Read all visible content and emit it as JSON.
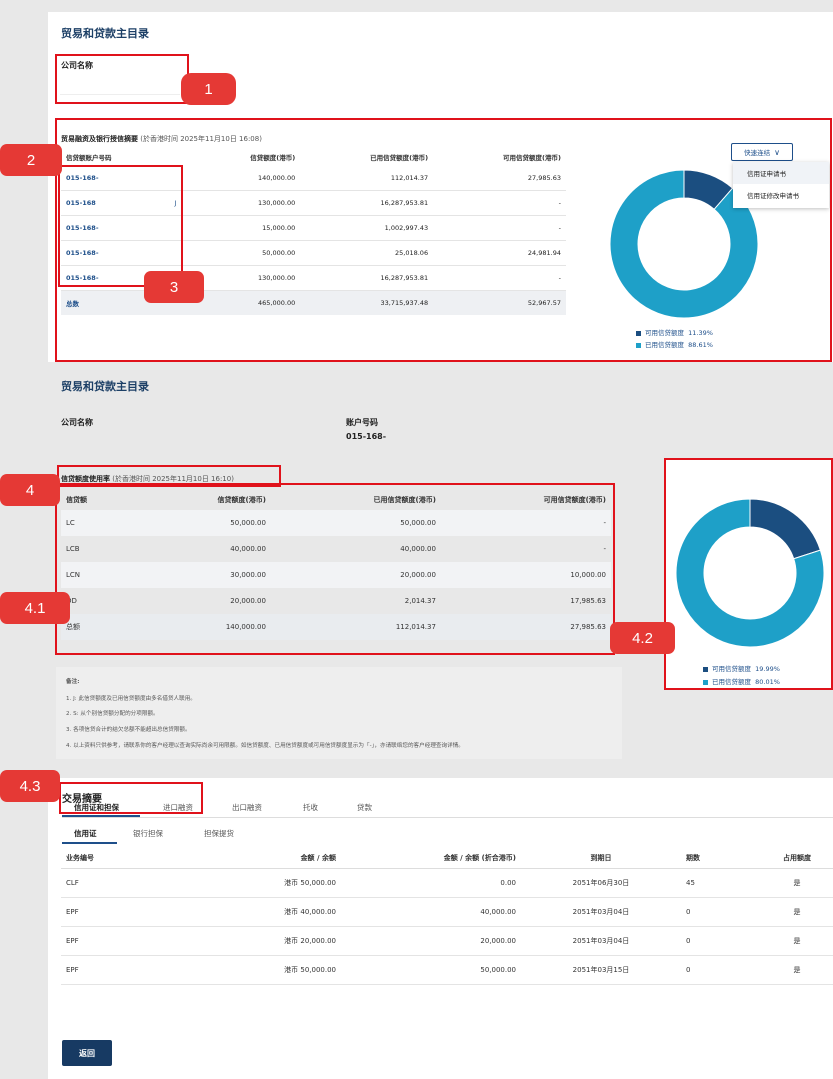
{
  "section1": {
    "title": "贸易和贷款主目录",
    "company_label": "公司名称",
    "summary_title": "贸易融资及银行授信摘要",
    "summary_time": "(於香港时间 2025年11月10日 16:08)",
    "columns": [
      "信贷额账户号码",
      "",
      "信贷额度(港币)",
      "已用信贷额度(港币)",
      "可用信贷额度(港币)"
    ],
    "rows": [
      {
        "acct": "015-168-",
        "flag": "",
        "limit": "140,000.00",
        "used": "112,014.37",
        "avail": "27,985.63"
      },
      {
        "acct": "015-168",
        "flag": "J",
        "limit": "130,000.00",
        "used": "16,287,953.81",
        "avail": "-"
      },
      {
        "acct": "015-168-",
        "flag": "",
        "limit": "15,000.00",
        "used": "1,002,997.43",
        "avail": "-"
      },
      {
        "acct": "015-168-",
        "flag": "",
        "limit": "50,000.00",
        "used": "25,018.06",
        "avail": "24,981.94"
      },
      {
        "acct": "015-168-",
        "flag": "J",
        "limit": "130,000.00",
        "used": "16,287,953.81",
        "avail": "-"
      }
    ],
    "total": {
      "label": "总数",
      "limit": "465,000.00",
      "used": "33,715,937.48",
      "avail": "52,967.57"
    },
    "quick_link": {
      "label": "快速连结",
      "items": [
        "信用证申请书",
        "信用证修改申请书"
      ]
    },
    "legend": [
      {
        "label": "可用信贷额度",
        "value": "11.39%",
        "color": "#1b4e80"
      },
      {
        "label": "已用信贷额度",
        "value": "88.61%",
        "color": "#1ea0c8"
      }
    ]
  },
  "section2": {
    "title": "贸易和贷款主目录",
    "company_label": "公司名称",
    "account_label": "账户号码",
    "account_value": "015-168-",
    "usage_title": "信贷额度使用率",
    "usage_time": "(於香港时间 2025年11月10日 16:10)",
    "columns": [
      "信贷额",
      "信贷额度(港币)",
      "已用信贷额度(港币)",
      "可用信贷额度(港币)"
    ],
    "rows": [
      {
        "name": "LC",
        "limit": "50,000.00",
        "used": "50,000.00",
        "avail": "-"
      },
      {
        "name": "LCB",
        "limit": "40,000.00",
        "used": "40,000.00",
        "avail": "-"
      },
      {
        "name": "LCN",
        "limit": "30,000.00",
        "used": "20,000.00",
        "avail": "10,000.00"
      },
      {
        "name": "OD",
        "limit": "20,000.00",
        "used": "2,014.37",
        "avail": "17,985.63"
      }
    ],
    "total": {
      "name": "总额",
      "limit": "140,000.00",
      "used": "112,014.37",
      "avail": "27,985.63"
    },
    "notes_title": "备注:",
    "notes": [
      "1. J: 此信贷额度及已用信贷额度由多名借贷人联用。",
      "2. S: 从个别信贷额分配的分项限额。",
      "3. 各项信贷合计的结欠总额不能超出总信贷限额。",
      "4. 以上资料只供参考，请联系你的客户经理以查询实际尚余可用限额。如信贷额度、已用信贷额度或可用信贷额度显示为「-」，亦请联络您的客户经理查询详情。"
    ],
    "legend": [
      {
        "label": "可用信贷额度",
        "value": "19.99%",
        "color": "#1b4e80"
      },
      {
        "label": "已用信贷额度",
        "value": "80.01%",
        "color": "#1ea0c8"
      }
    ]
  },
  "section3": {
    "title": "交易摘要",
    "tabs": [
      "信用证和担保",
      "进口融资",
      "出口融资",
      "托收",
      "贷款"
    ],
    "subtabs": [
      "信用证",
      "银行担保",
      "担保提货"
    ],
    "columns": [
      "业务编号",
      "金额 / 余额",
      "金额 / 余额 (折合港币)",
      "到期日",
      "期数",
      "占用额度"
    ],
    "rows": [
      {
        "ref": "CLF",
        "amount": "港币 50,000.00",
        "hkd": "0.00",
        "expiry": "2051年06月30日",
        "period": "45",
        "occupy": "是"
      },
      {
        "ref": "EPF",
        "amount": "港币 40,000.00",
        "hkd": "40,000.00",
        "expiry": "2051年03月04日",
        "period": "0",
        "occupy": "是"
      },
      {
        "ref": "EPF",
        "amount": "港币 20,000.00",
        "hkd": "20,000.00",
        "expiry": "2051年03月04日",
        "period": "0",
        "occupy": "是"
      },
      {
        "ref": "EPF",
        "amount": "港币 50,000.00",
        "hkd": "50,000.00",
        "expiry": "2051年03月15日",
        "period": "0",
        "occupy": "是"
      }
    ],
    "back_button": "返回"
  },
  "markers": [
    "1",
    "2",
    "3",
    "4",
    "4.1",
    "4.2",
    "4.3"
  ],
  "colors": {
    "brand": "#1c3f66",
    "annotation": "#e0121b",
    "available": "#1b4e80",
    "used": "#1ea0c8"
  }
}
